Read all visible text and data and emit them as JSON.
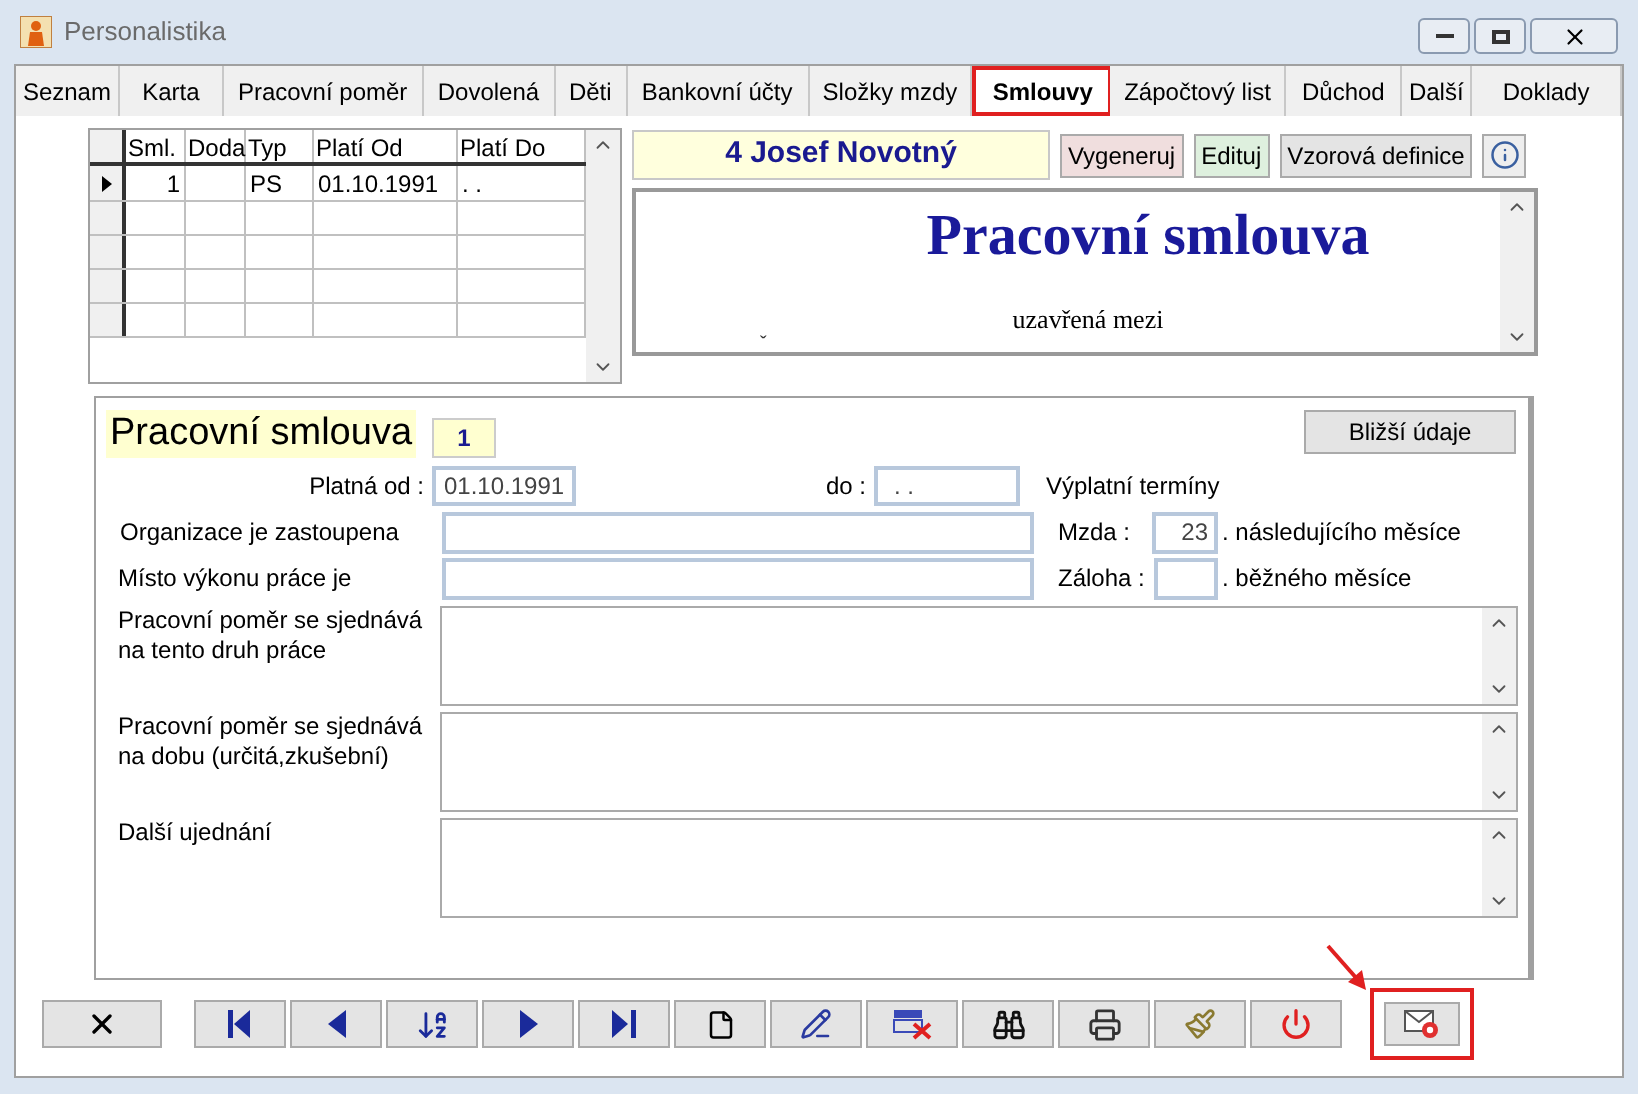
{
  "window": {
    "title": "Personalistika"
  },
  "tabs": [
    {
      "label": "Seznam",
      "selected": false,
      "highlighted": false
    },
    {
      "label": "Karta",
      "selected": false,
      "highlighted": false
    },
    {
      "label": "Pracovní poměr",
      "selected": false,
      "highlighted": false
    },
    {
      "label": "Dovolená",
      "selected": false,
      "highlighted": false
    },
    {
      "label": "Děti",
      "selected": false,
      "highlighted": false
    },
    {
      "label": "Bankovní účty",
      "selected": false,
      "highlighted": false
    },
    {
      "label": "Složky mzdy",
      "selected": false,
      "highlighted": false
    },
    {
      "label": "Smlouvy",
      "selected": true,
      "highlighted": true
    },
    {
      "label": "Zápočtový list",
      "selected": false,
      "highlighted": false
    },
    {
      "label": "Důchod",
      "selected": false,
      "highlighted": false
    },
    {
      "label": "Další",
      "selected": false,
      "highlighted": false
    },
    {
      "label": "Doklady",
      "selected": false,
      "highlighted": false
    }
  ],
  "contracts_table": {
    "columns": [
      "Sml.",
      "Doda",
      "Typ",
      "Platí Od",
      "Platí Do"
    ],
    "rows": [
      {
        "cells": [
          "1",
          "",
          "PS",
          "01.10.1991",
          ". ."
        ],
        "current": true
      }
    ]
  },
  "employee_name": "4 Josef Novotný",
  "actions": [
    {
      "label": "Vygeneruj",
      "color": "#f0dede"
    },
    {
      "label": "Edituj",
      "color": "#def0de"
    },
    {
      "label": "Vzorová definice",
      "color": "#e4e4e4"
    }
  ],
  "document_preview": {
    "heading": "Pracovní smlouva",
    "subtitle": "uzavřená mezi",
    "cursor_mark": "ˇ"
  },
  "contract": {
    "title": "Pracovní smlouva",
    "number": "1",
    "details_button": "Bližší údaje",
    "valid_from_label": "Platná od :",
    "valid_from": "01.10.1991",
    "valid_to_label": "do :",
    "valid_to": ". .",
    "pay_terms_label": "Výplatní termíny",
    "organization_label": "Organizace je zastoupena",
    "workplace_label": "Místo výkonu práce je",
    "wage_label": "Mzda :",
    "wage_day": "23",
    "wage_suffix": ". následujícího měsíce",
    "advance_label": "Záloha :",
    "advance_suffix": ". běžného měsíce",
    "memos": [
      {
        "label": "Pracovní poměr se sjednává na tento druh práce"
      },
      {
        "label": "Pracovní poměr se sjednává na dobu (určitá,zkušební)"
      },
      {
        "label": "Další ujednání"
      }
    ]
  },
  "toolbar": [
    {
      "kind": "close"
    },
    {
      "kind": "first"
    },
    {
      "kind": "prev"
    },
    {
      "kind": "sort"
    },
    {
      "kind": "next"
    },
    {
      "kind": "last"
    },
    {
      "kind": "new"
    },
    {
      "kind": "edit"
    },
    {
      "kind": "delete"
    },
    {
      "kind": "find"
    },
    {
      "kind": "print"
    },
    {
      "kind": "tool"
    },
    {
      "kind": "power"
    }
  ],
  "email_button": {
    "highlighted": true
  }
}
